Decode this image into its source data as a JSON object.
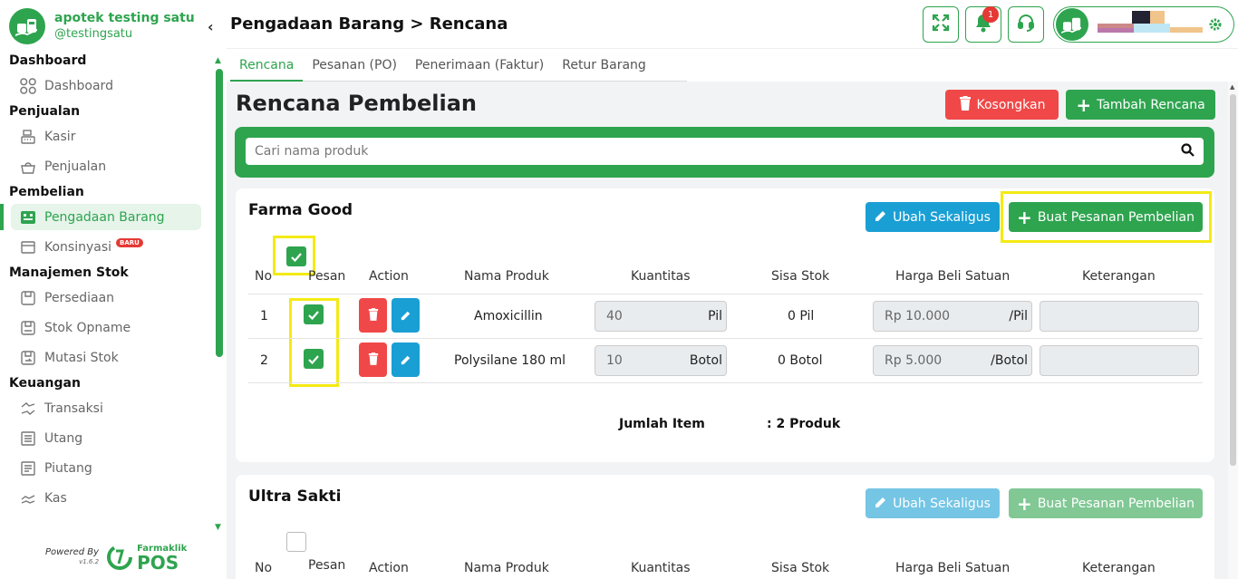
{
  "store": {
    "name": "apotek testing satu",
    "handle": "@testingsatu"
  },
  "sidebar": {
    "sections": [
      {
        "title": "Dashboard",
        "items": [
          {
            "label": "Dashboard",
            "icon": "grid-icon"
          }
        ]
      },
      {
        "title": "Penjualan",
        "items": [
          {
            "label": "Kasir",
            "icon": "cash-register-icon"
          },
          {
            "label": "Penjualan",
            "icon": "basket-icon"
          }
        ]
      },
      {
        "title": "Pembelian",
        "items": [
          {
            "label": "Pengadaan Barang",
            "icon": "procurement-icon",
            "active": true
          },
          {
            "label": "Konsinyasi",
            "icon": "consign-icon",
            "badge": "BARU"
          }
        ]
      },
      {
        "title": "Manajemen Stok",
        "items": [
          {
            "label": "Persediaan",
            "icon": "box-icon"
          },
          {
            "label": "Stok Opname",
            "icon": "clipboard-icon"
          },
          {
            "label": "Mutasi Stok",
            "icon": "transfer-box-icon"
          }
        ]
      },
      {
        "title": "Keuangan",
        "items": [
          {
            "label": "Transaksi",
            "icon": "exchange-icon"
          },
          {
            "label": "Utang",
            "icon": "list-icon"
          },
          {
            "label": "Piutang",
            "icon": "receipt-icon"
          },
          {
            "label": "Kas",
            "icon": "cash-hand-icon"
          }
        ]
      }
    ]
  },
  "powered": {
    "text": "Powered By",
    "version": "v1.6.2",
    "brand_top": "Farmaklik",
    "brand_bottom": "POS"
  },
  "header": {
    "title": "Pengadaan Barang > Rencana",
    "notif_count": "1"
  },
  "tabs": [
    "Rencana",
    "Pesanan (PO)",
    "Penerimaan (Faktur)",
    "Retur Barang"
  ],
  "page": {
    "heading": "Rencana Pembelian",
    "clear_label": "Kosongkan",
    "add_label": "Tambah Rencana",
    "search_placeholder": "Cari nama produk"
  },
  "columns": [
    "No",
    "Pesan",
    "Action",
    "Nama Produk",
    "Kuantitas",
    "Sisa Stok",
    "Harga Beli Satuan",
    "Keterangan"
  ],
  "suppliers": [
    {
      "name": "Farma Good",
      "edit_all_label": "Ubah Sekaligus",
      "create_po_label": "Buat Pesanan Pembelian",
      "rows": [
        {
          "no": "1",
          "product": "Amoxicillin",
          "qty": "40",
          "qty_unit": "Pil",
          "stock": "0 Pil",
          "price": "Rp 10.000",
          "price_unit": "/Pil",
          "note": "",
          "checked": true
        },
        {
          "no": "2",
          "product": "Polysilane 180 ml",
          "qty": "10",
          "qty_unit": "Botol",
          "stock": "0 Botol",
          "price": "Rp 5.000",
          "price_unit": "/Botol",
          "note": "",
          "checked": true
        }
      ],
      "summary_label": "Jumlah Item",
      "summary_value": ": 2 Produk"
    },
    {
      "name": "Ultra Sakti",
      "edit_all_label": "Ubah Sekaligus",
      "create_po_label": "Buat Pesanan Pembelian"
    }
  ],
  "colors": {
    "primary": "#2ea44f",
    "danger": "#f04848",
    "info": "#1a9fd4",
    "highlight": "#f4ea15"
  }
}
